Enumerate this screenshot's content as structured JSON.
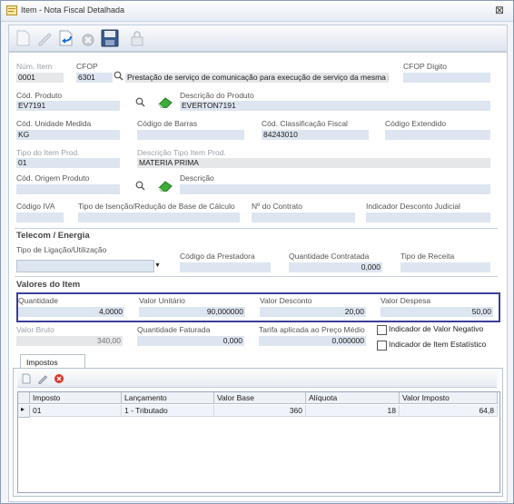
{
  "window": {
    "title": "Item - Nota Fiscal Detalhada",
    "close_glyph": "⊠"
  },
  "toolbar": {
    "icons": [
      "new-icon",
      "edit-icon",
      "undo-icon",
      "cancel-icon",
      "save-icon",
      "lock-icon"
    ]
  },
  "fields": {
    "num_item": {
      "label": "Núm. Item",
      "value": "0001"
    },
    "cfop": {
      "label": "CFOP",
      "value": "6301",
      "description": "Prestação de serviço de comunicação para execução de serviço da mesma n"
    },
    "cfop_digito": {
      "label": "CFOP Dígito",
      "value": ""
    },
    "cod_produto": {
      "label": "Cód. Produto",
      "value": "EV7191"
    },
    "desc_produto": {
      "label": "Descrição do Produto",
      "value": "EVERTON7191"
    },
    "cod_unidade": {
      "label": "Cód. Unidade Medida",
      "value": "KG"
    },
    "cod_barras": {
      "label": "Código de Barras",
      "value": ""
    },
    "cod_class_fiscal": {
      "label": "Cód. Classificação Fiscal",
      "value": "84243010"
    },
    "cod_extendido": {
      "label": "Código Extendido",
      "value": ""
    },
    "tipo_item": {
      "label": "Tipo do Item Prod.",
      "value": "01"
    },
    "desc_tipo_item": {
      "label": "Descrição Tipo Item Prod.",
      "value": "MATERIA PRIMA"
    },
    "cod_origem": {
      "label": "Cód. Origem Produto",
      "value": ""
    },
    "descricao": {
      "label": "Descrição",
      "value": ""
    },
    "cod_iva": {
      "label": "Código IVA",
      "value": ""
    },
    "tipo_isencao": {
      "label": "Tipo de Isenção/Redução de Base de Cálculo",
      "value": ""
    },
    "num_contrato": {
      "label": "Nº do Contrato",
      "value": ""
    },
    "ind_desc_judicial": {
      "label": "Indicador Desconto Judicial",
      "value": ""
    }
  },
  "telecom": {
    "title": "Telecom / Energia",
    "tipo_ligacao": {
      "label": "Tipo de Ligação/Utilização",
      "value": ""
    },
    "cod_prestadora": {
      "label": "Código da Prestadora",
      "value": ""
    },
    "qtd_contratada": {
      "label": "Quantidade Contratada",
      "value": "0,000"
    },
    "tipo_receita": {
      "label": "Tipo de Receita",
      "value": ""
    }
  },
  "valores": {
    "title": "Valores do Item",
    "quantidade": {
      "label": "Quantidade",
      "value": "4,0000"
    },
    "valor_unitario": {
      "label": "Valor Unitário",
      "value": "90,000000"
    },
    "valor_desconto": {
      "label": "Valor Desconto",
      "value": "20,00"
    },
    "valor_despesa": {
      "label": "Valor Despesa",
      "value": "50,00"
    },
    "valor_bruto": {
      "label": "Valor Bruto",
      "value": "340,00"
    },
    "qtd_faturada": {
      "label": "Quantidade Faturada",
      "value": "0,000"
    },
    "tarifa": {
      "label": "Tarifa aplicada ao Preço Médio",
      "value": "0,000000"
    },
    "ind_valor_negativo": {
      "label": "Indicador de Valor Negativo"
    },
    "ind_item_estatistico": {
      "label": "Indicador de Item Estatístico"
    }
  },
  "impostos": {
    "tab_label": "Impostos",
    "columns": [
      "Imposto",
      "Lançamento",
      "Valor Base",
      "Alíquota",
      "Valor Imposto"
    ],
    "rows": [
      {
        "imposto": "01",
        "lancamento": "1 - Tributado",
        "valor_base": "360",
        "aliquota": "18",
        "valor_imposto": "64,8"
      }
    ]
  },
  "colors": {
    "accent_border": "#3b3f99",
    "field_bg": "#dde5f0"
  }
}
